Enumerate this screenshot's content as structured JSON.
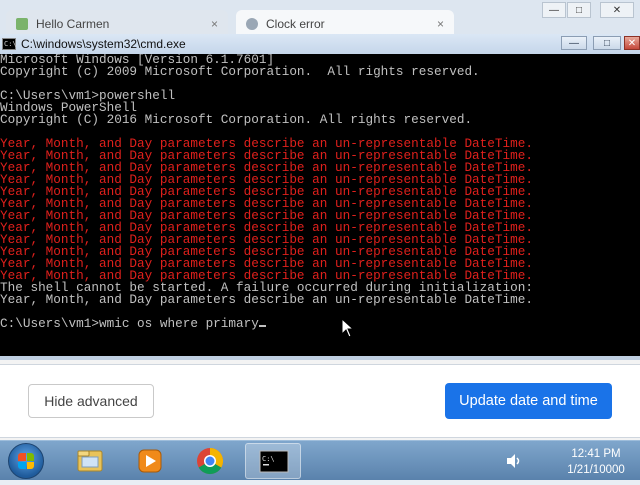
{
  "browser": {
    "tabs": [
      {
        "label": "Hello Carmen",
        "close": "×"
      },
      {
        "label": "Clock error",
        "close": "×"
      }
    ],
    "window_controls": [
      "—",
      "□",
      "✕"
    ]
  },
  "cmd_window": {
    "title": "C:\\windows\\system32\\cmd.exe",
    "controls": {
      "minimize": "—",
      "maximize": "□",
      "close": "✕"
    },
    "lines": [
      {
        "text": "Microsoft Windows [Version 6.1.7601]",
        "color": "gray"
      },
      {
        "text": "Copyright (c) 2009 Microsoft Corporation.  All rights reserved.",
        "color": "gray"
      },
      {
        "text": "",
        "color": "gray"
      },
      {
        "text": "C:\\Users\\vm1>powershell",
        "color": "gray"
      },
      {
        "text": "Windows PowerShell",
        "color": "gray"
      },
      {
        "text": "Copyright (C) 2016 Microsoft Corporation. All rights reserved.",
        "color": "gray"
      },
      {
        "text": "",
        "color": "gray"
      },
      {
        "text": "Year, Month, and Day parameters describe an un-representable DateTime.",
        "color": "red"
      },
      {
        "text": "Year, Month, and Day parameters describe an un-representable DateTime.",
        "color": "red"
      },
      {
        "text": "Year, Month, and Day parameters describe an un-representable DateTime.",
        "color": "red"
      },
      {
        "text": "Year, Month, and Day parameters describe an un-representable DateTime.",
        "color": "red"
      },
      {
        "text": "Year, Month, and Day parameters describe an un-representable DateTime.",
        "color": "red"
      },
      {
        "text": "Year, Month, and Day parameters describe an un-representable DateTime.",
        "color": "red"
      },
      {
        "text": "Year, Month, and Day parameters describe an un-representable DateTime.",
        "color": "red"
      },
      {
        "text": "Year, Month, and Day parameters describe an un-representable DateTime.",
        "color": "red"
      },
      {
        "text": "Year, Month, and Day parameters describe an un-representable DateTime.",
        "color": "red"
      },
      {
        "text": "Year, Month, and Day parameters describe an un-representable DateTime.",
        "color": "red"
      },
      {
        "text": "Year, Month, and Day parameters describe an un-representable DateTime.",
        "color": "red"
      },
      {
        "text": "Year, Month, and Day parameters describe an un-representable DateTime.",
        "color": "red"
      },
      {
        "text": "The shell cannot be started. A failure occurred during initialization:",
        "color": "gray"
      },
      {
        "text": "Year, Month, and Day parameters describe an un-representable DateTime.",
        "color": "gray"
      },
      {
        "text": "",
        "color": "gray"
      },
      {
        "text": "C:\\Users\\vm1>wmic os where primary",
        "color": "gray"
      }
    ]
  },
  "settings_strip": {
    "hide_advanced_label": "Hide advanced",
    "update_label": "Update date and time"
  },
  "taskbar": {
    "items": [
      "file-explorer-icon",
      "media-player-icon",
      "chrome-icon",
      "cmd-icon"
    ],
    "active_item": "cmd-icon",
    "clock_time": "12:41 PM",
    "clock_date": "1/21/10000"
  },
  "colors": {
    "console_bg": "#000000",
    "console_text": "#c0c0c0",
    "console_error": "#e0201c",
    "accent": "#1a73e8"
  }
}
